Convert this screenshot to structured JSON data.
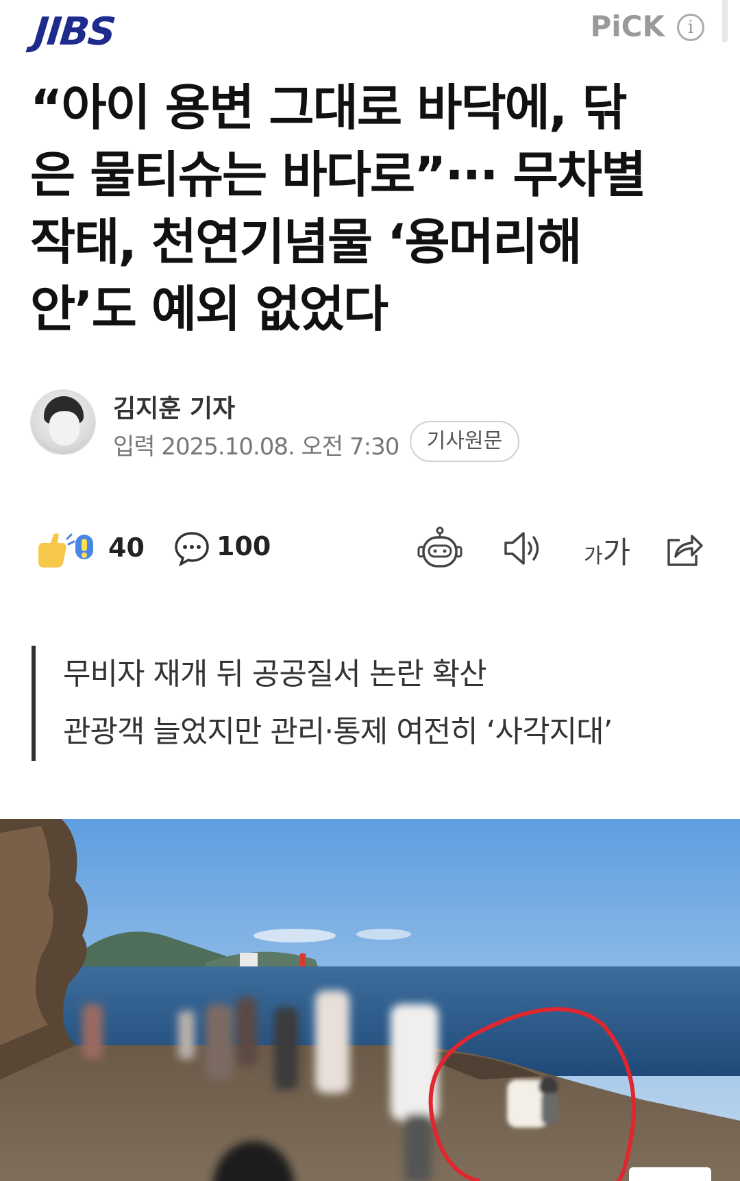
{
  "header": {
    "logo": "JIBS",
    "pick_label": "PiCK",
    "info_glyph": "i"
  },
  "article": {
    "headline_lines": [
      "“아이 용변 그대로 바닥에, 닦",
      "은 물티슈는 바다로”··· 무차별",
      "작태, 천연기념물 ‘용머리해",
      "안’도 예외 없었다"
    ],
    "reporter": "김지훈 기자",
    "published": "입력 2025.10.08. 오전 7:30",
    "original_button": "기사원문",
    "summary_lines": [
      "무비자 재개 뒤 공공질서 논란 확산",
      "관광객 늘었지만 관리·통제 여전히 ‘사각지대’"
    ]
  },
  "actions": {
    "reaction_count": "40",
    "comment_count": "100",
    "font_size_small": "가",
    "font_size_large": "가",
    "icons": [
      "reaction-icon",
      "comment-icon",
      "robot-summary-icon",
      "speaker-icon",
      "font-size-icon",
      "share-icon"
    ]
  },
  "colors": {
    "logo": "#1e2a8c",
    "pick": "#9a9a9a",
    "text": "#111111",
    "meta": "#777777",
    "annotation_circle": "#e0262e",
    "sky": "#6fa8e0",
    "sea": "#2f5f8f"
  }
}
